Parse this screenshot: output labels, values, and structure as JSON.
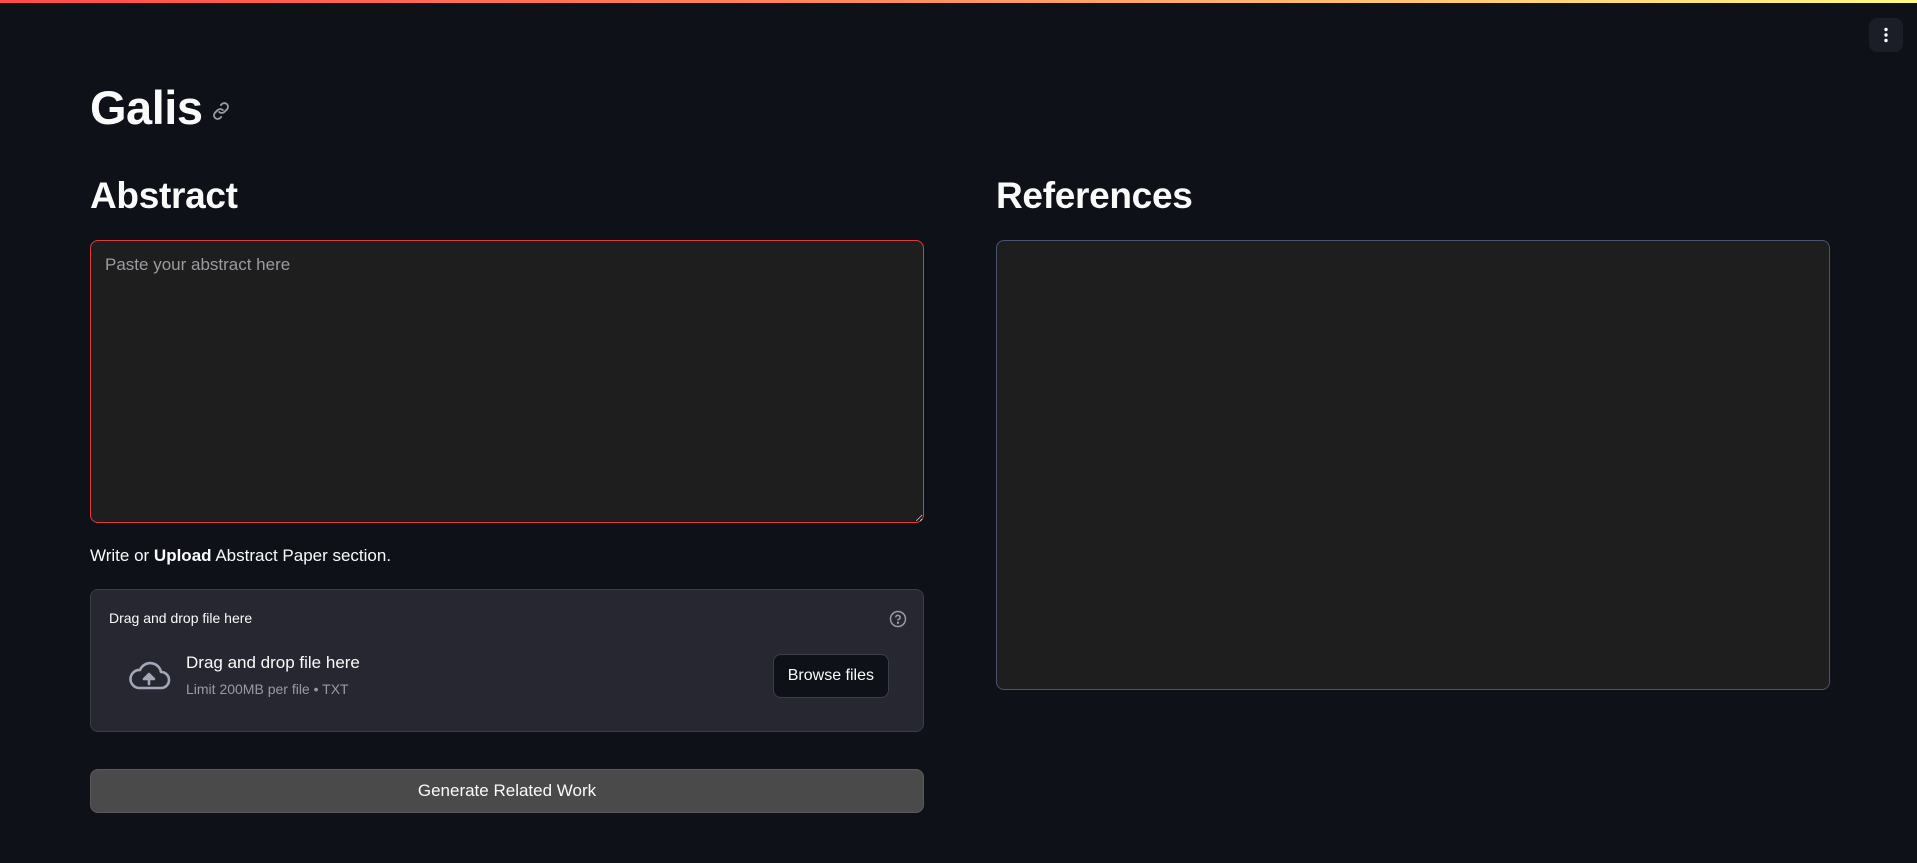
{
  "app": {
    "title": "Galis",
    "accent_gradient": [
      "#ff4b4b",
      "#fffd80"
    ],
    "background": "#0e1117"
  },
  "abstract": {
    "heading": "Abstract",
    "placeholder": "Paste your abstract here",
    "value": "",
    "caption_prefix": "Write or ",
    "caption_bold": "Upload",
    "caption_suffix": " Abstract Paper section."
  },
  "uploader": {
    "label": "Drag and drop file here",
    "drop_title": "Drag and drop file here",
    "limit_text": "Limit 200MB per file • TXT",
    "browse_label": "Browse files",
    "icons": {
      "help": "help-circle-icon",
      "upload": "cloud-upload-icon"
    }
  },
  "actions": {
    "generate_label": "Generate Related Work"
  },
  "references": {
    "heading": "References",
    "content": ""
  },
  "header": {
    "menu_icon": "kebab-menu-icon",
    "anchor_icon": "link-icon"
  }
}
